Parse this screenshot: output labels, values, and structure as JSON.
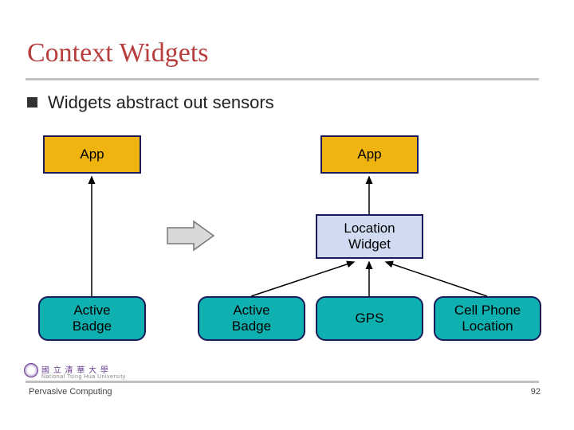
{
  "slide": {
    "title": "Context Widgets",
    "bullet": "Widgets abstract out sensors",
    "colors": {
      "title": "#b83d3d",
      "app_box": "#efb410",
      "sensor_box": "#0fb0b0",
      "widget_box": "#d0daf0",
      "box_border": "#1a1a5a"
    }
  },
  "diagram": {
    "left": {
      "app": "App",
      "sensor": "Active\nBadge"
    },
    "right": {
      "app": "App",
      "widget": "Location\nWidget",
      "sensors": [
        "Active\nBadge",
        "GPS",
        "Cell Phone\nLocation"
      ]
    }
  },
  "footer": {
    "left": "Pervasive Computing",
    "page": "92",
    "affiliation": "國 立 清 華 大 學",
    "affiliation_sub": "National Tsing Hua University"
  }
}
